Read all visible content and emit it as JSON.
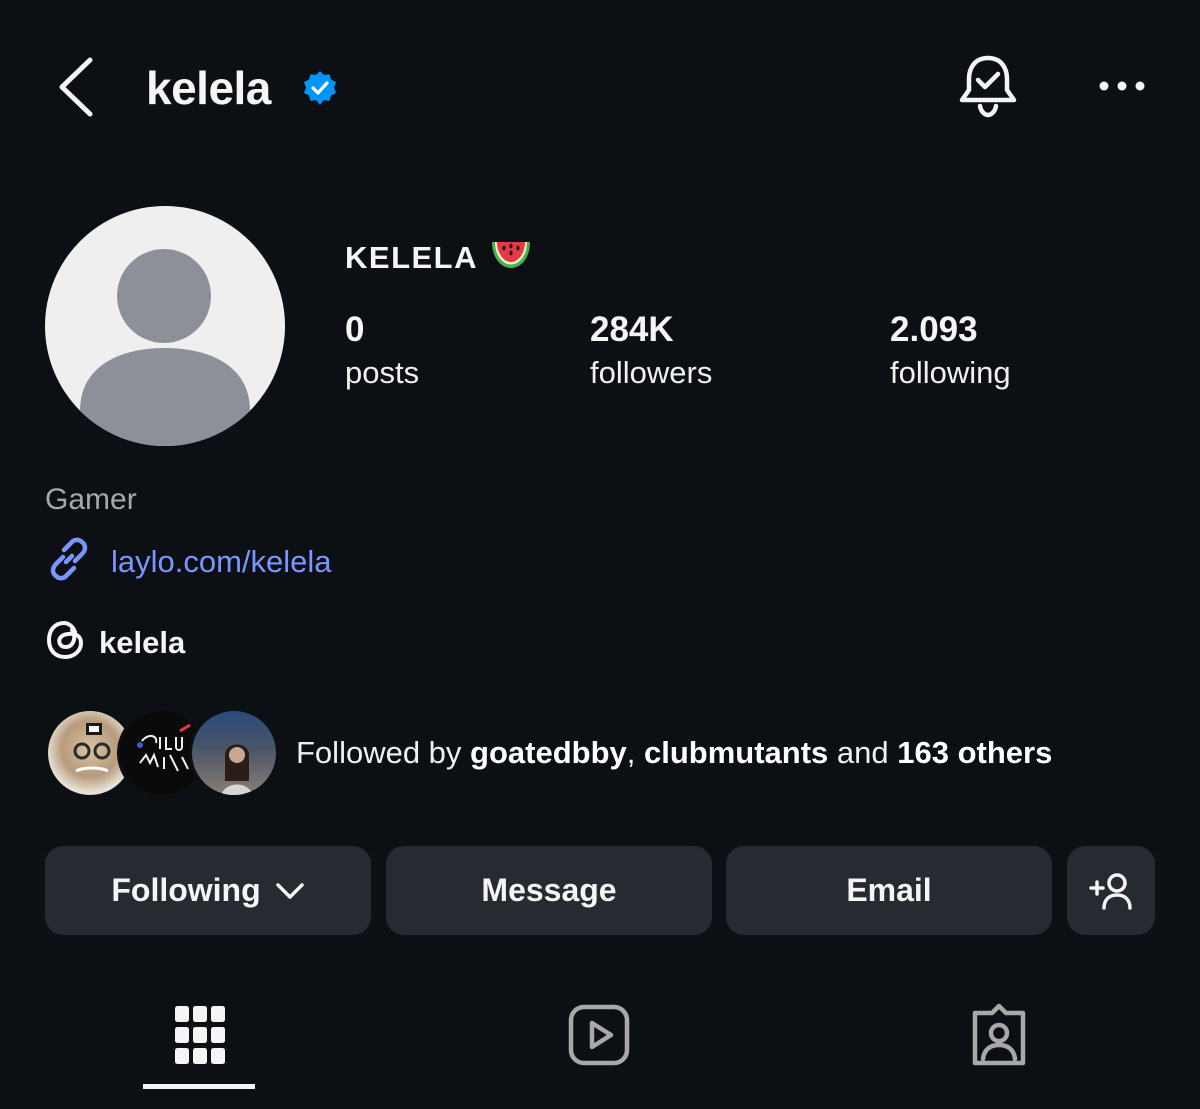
{
  "header": {
    "username": "kelela",
    "back_icon": "chevron-left-icon",
    "verified_icon": "verified-badge-icon",
    "bell_icon": "bell-check-icon",
    "more_icon": "more-horizontal-icon"
  },
  "profile": {
    "display_name": "KELELA",
    "display_emoji": "🍉",
    "avatar_icon": "default-avatar-icon",
    "stats": [
      {
        "value": "0",
        "label": "posts"
      },
      {
        "value": "284K",
        "label": "followers"
      },
      {
        "value": "2.093",
        "label": "following"
      }
    ]
  },
  "bio": {
    "category": "Gamer",
    "link_icon": "link-icon",
    "link": "laylo.com/kelela",
    "threads_icon": "threads-icon",
    "threads_handle": "kelela"
  },
  "followed_by": {
    "prefix": "Followed by ",
    "user1": "goatedbby",
    "separator": ", ",
    "user2": "clubmutants",
    "joiner": " and ",
    "others": "163 others"
  },
  "buttons": {
    "following": "Following",
    "message": "Message",
    "email": "Email",
    "add_icon": "add-person-icon"
  },
  "tabs": [
    {
      "icon": "grid-icon",
      "active": true
    },
    {
      "icon": "reels-icon",
      "active": false
    },
    {
      "icon": "tagged-icon",
      "active": false
    }
  ],
  "colors": {
    "background": "#0c1014",
    "button": "#262a31",
    "link": "#7b95ff",
    "verified": "#0095f6",
    "muted_text": "#a8a8a8"
  }
}
